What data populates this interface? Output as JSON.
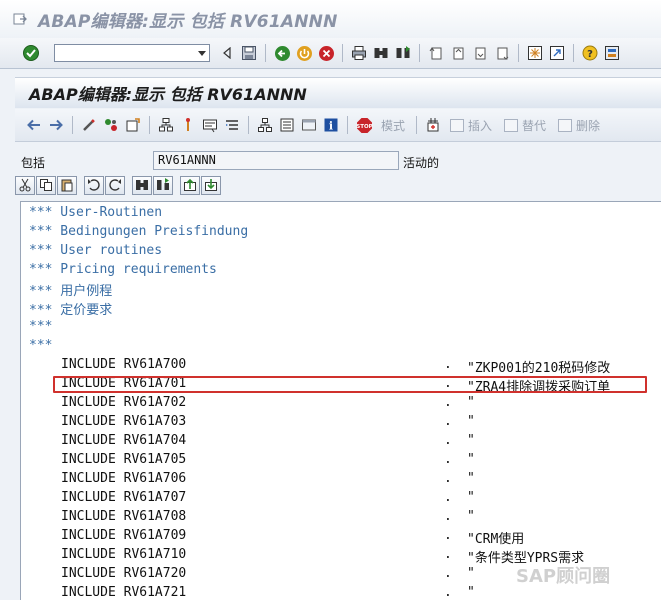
{
  "window": {
    "title": "ABAP编辑器:显示 包括 RV61ANNN"
  },
  "header": {
    "title": "ABAP编辑器:显示 包括 RV61ANNN"
  },
  "app_toolbar": {
    "mode_label": "模式",
    "insert_label": "插入",
    "replace_label": "替代",
    "delete_label": "删除"
  },
  "field": {
    "label": "包括",
    "value": "RV61ANNN",
    "status": "活动的"
  },
  "code": {
    "comments": [
      "*** User-Routinen",
      "*** Bedingungen Preisfindung",
      "*** User routines",
      "*** Pricing requirements",
      "*** 用户例程",
      "*** 定价要求",
      "***",
      "***"
    ],
    "includes": [
      {
        "stmt": "INCLUDE RV61A700",
        "dot": ".",
        "comment": "\"ZKP001的210税码修改"
      },
      {
        "stmt": "INCLUDE RV61A701",
        "dot": ".",
        "comment": "\"ZRA4排除调拨采购订单"
      },
      {
        "stmt": "INCLUDE RV61A702",
        "dot": ".",
        "comment": "\""
      },
      {
        "stmt": "INCLUDE RV61A703",
        "dot": ".",
        "comment": "\""
      },
      {
        "stmt": "INCLUDE RV61A704",
        "dot": ".",
        "comment": "\""
      },
      {
        "stmt": "INCLUDE RV61A705",
        "dot": ".",
        "comment": "\""
      },
      {
        "stmt": "INCLUDE RV61A706",
        "dot": ".",
        "comment": "\""
      },
      {
        "stmt": "INCLUDE RV61A707",
        "dot": ".",
        "comment": "\""
      },
      {
        "stmt": "INCLUDE RV61A708",
        "dot": ".",
        "comment": "\""
      },
      {
        "stmt": "INCLUDE RV61A709",
        "dot": ".",
        "comment": "\"CRM使用"
      },
      {
        "stmt": "INCLUDE RV61A710",
        "dot": ".",
        "comment": "\"条件类型YPRS需求"
      },
      {
        "stmt": "INCLUDE RV61A720",
        "dot": ".",
        "comment": "\""
      },
      {
        "stmt": "INCLUDE RV61A721",
        "dot": ".",
        "comment": "\""
      }
    ]
  },
  "watermark": "SAP顾问圈",
  "colors": {
    "comment": "#3a6ea5",
    "highlight": "#d0312d"
  }
}
